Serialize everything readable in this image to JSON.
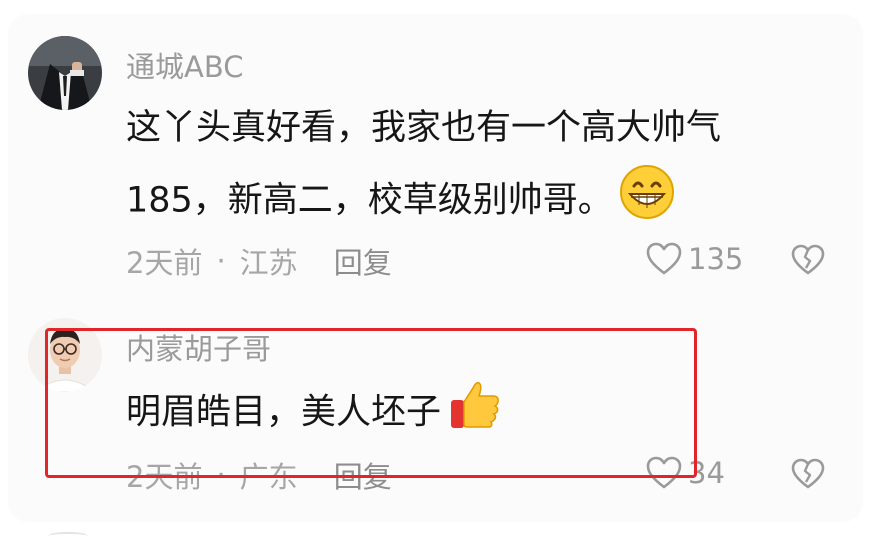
{
  "comments": [
    {
      "username": "通城ABC",
      "text_line1": "这丫头真好看，我家也有一个高大帅气",
      "text_line2": "185，新高二，校草级别帅哥。",
      "time": "2天前",
      "separator": "·",
      "location": "江苏",
      "reply_label": "回复",
      "likes": "135",
      "avatar_icon": "man-in-suit-avatar",
      "emoji_icon": "grinning-face-icon"
    },
    {
      "username": "内蒙胡子哥",
      "text_line1": "明眉皓目，美人坯子",
      "time": "2天前",
      "separator": "·",
      "location": "广东",
      "reply_label": "回复",
      "likes": "34",
      "avatar_icon": "glasses-man-avatar",
      "emoji_icon": "thumbs-up-icon"
    }
  ],
  "colors": {
    "highlight": "#e0262b",
    "username": "#9a9a9a",
    "text": "#161616"
  }
}
